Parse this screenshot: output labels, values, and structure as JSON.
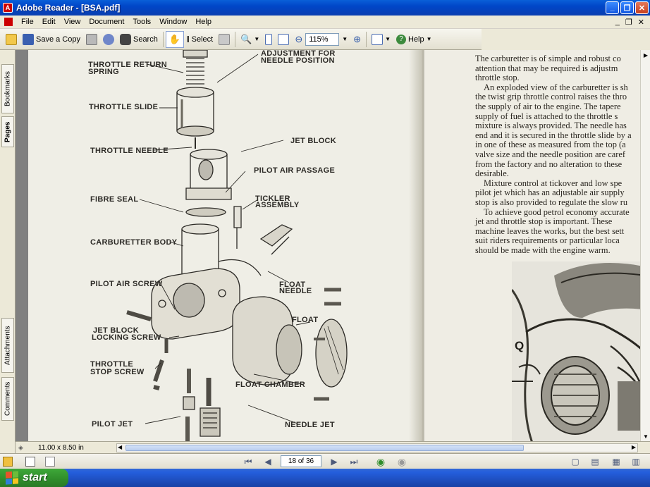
{
  "window": {
    "title": "Adobe Reader - [BSA.pdf]",
    "app_icon": "adobe-reader-icon",
    "controls": [
      "_",
      "❐",
      "✕"
    ]
  },
  "menu": {
    "items": [
      "File",
      "Edit",
      "View",
      "Document",
      "Tools",
      "Window",
      "Help"
    ],
    "doc_controls": [
      "_",
      "❐",
      "✕"
    ]
  },
  "toolbar": {
    "save_copy": "Save a Copy",
    "search": "Search",
    "select": "Select",
    "zoom_value": "115%",
    "help": "Help"
  },
  "side_tabs": {
    "bookmarks": "Bookmarks",
    "pages": "Pages",
    "attachments": "Attachments",
    "comments": "Comments"
  },
  "diagram": {
    "labels": [
      "THROTTLE RETURN",
      "SPRING",
      "ADJUSTMENT FOR",
      "NEEDLE POSITION",
      "THROTTLE SLIDE",
      "THROTTLE NEEDLE",
      "JET BLOCK",
      "PILOT AIR PASSAGE",
      "FIBRE SEAL",
      "TICKLER",
      "ASSEMBLY",
      "CARBURETTER BODY",
      "PILOT AIR SCREW",
      "FLOAT",
      "NEEDLE",
      "FLOAT",
      "JET BLOCK",
      "LOCKING SCREW",
      "THROTTLE",
      "STOP SCREW",
      "FLOAT CHAMBER",
      "PILOT JET",
      "NEEDLE JET"
    ]
  },
  "text_page": {
    "lines": [
      "The carburetter is of simple and robust co",
      "attention that may be required is adjustm",
      "throttle stop.",
      "An exploded view of the carburetter is sh",
      "the twist grip throttle control raises the thro",
      "the supply of air to the engine. The tapere",
      "supply of fuel is attached to the throttle s",
      "mixture is always provided. The needle has",
      "end and it is secured in the throttle slide by a",
      "in one of these as measured from the top (a",
      "valve size and the needle position are caref",
      "from the factory and no alteration to these",
      "desirable.",
      "Mixture control at tickover and low spe",
      "pilot jet which has an adjustable air supply",
      "stop is also provided to regulate the slow ru",
      "To achieve good petrol economy accurate",
      "jet and throttle stop is important. These",
      "machine leaves the works, but the best sett",
      "suit riders requirements or particular loca",
      "should be made with the engine warm."
    ],
    "photo_label": "Q"
  },
  "status": {
    "page_size": "11.00 x 8.50 in"
  },
  "nav": {
    "page_indicator": "18 of 36"
  },
  "taskbar": {
    "start_label": "start"
  }
}
